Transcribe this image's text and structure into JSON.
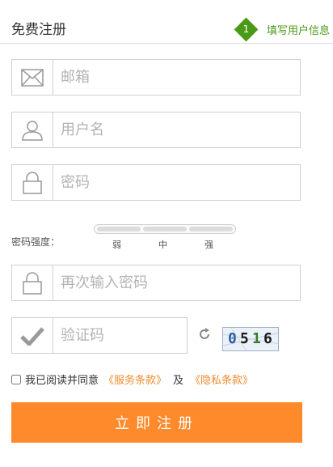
{
  "header": {
    "title": "免费注册",
    "step_number": "1",
    "step_label": "填写用户信息",
    "step_color": "#4a9a17"
  },
  "fields": {
    "email": {
      "placeholder": "邮箱",
      "value": "",
      "icon": "envelope-icon"
    },
    "username": {
      "placeholder": "用户名",
      "value": "",
      "icon": "user-icon"
    },
    "password": {
      "placeholder": "密码",
      "value": "",
      "icon": "lock-icon"
    },
    "confirm_password": {
      "placeholder": "再次输入密码",
      "value": "",
      "icon": "lock-icon"
    },
    "captcha": {
      "placeholder": "验证码",
      "value": "",
      "icon": "checkmark-icon"
    }
  },
  "strength": {
    "label": "密码强度：",
    "weak": "弱",
    "medium": "中",
    "strong": "强"
  },
  "captcha_image": {
    "digits": [
      "0",
      "5",
      "1",
      "6"
    ],
    "refresh_icon": "refresh-icon"
  },
  "agreement": {
    "prefix": "我已阅读并同意",
    "service_link": "《服务条款》",
    "and": "及",
    "privacy_link": "《隐私条款》",
    "checked": false,
    "link_color": "#f08b2c"
  },
  "submit_label": "立即注册",
  "accent_color": "#ff8a2b"
}
